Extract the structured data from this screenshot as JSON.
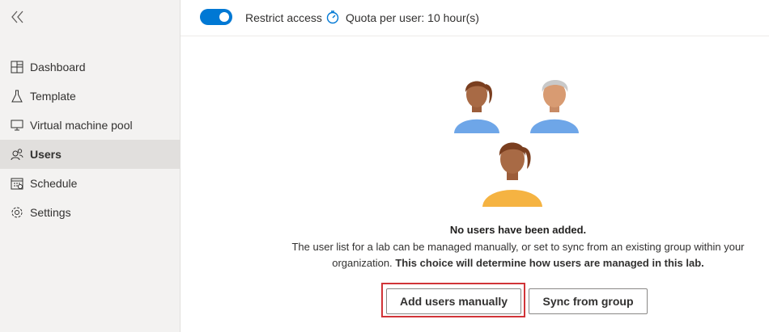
{
  "sidebar": {
    "items": [
      {
        "label": "Dashboard",
        "icon": "dashboard-icon"
      },
      {
        "label": "Template",
        "icon": "flask-icon"
      },
      {
        "label": "Virtual machine pool",
        "icon": "monitor-icon"
      },
      {
        "label": "Users",
        "icon": "users-icon",
        "active": true
      },
      {
        "label": "Schedule",
        "icon": "calendar-icon"
      },
      {
        "label": "Settings",
        "icon": "gear-icon"
      }
    ]
  },
  "topbar": {
    "restrict_label": "Restrict access",
    "restrict_on": true,
    "quota_label": "Quota per user: 10 hour(s)"
  },
  "empty_state": {
    "title": "No users have been added.",
    "description": "The user list for a lab can be managed manually, or set to sync from an existing group within your organization.",
    "emphasis": "This choice will determine how users are managed in this lab.",
    "add_button": "Add users manually",
    "sync_button": "Sync from group"
  },
  "colors": {
    "accent": "#0078d4",
    "highlight": "#d13438",
    "sidebar_bg": "#f3f2f1"
  }
}
